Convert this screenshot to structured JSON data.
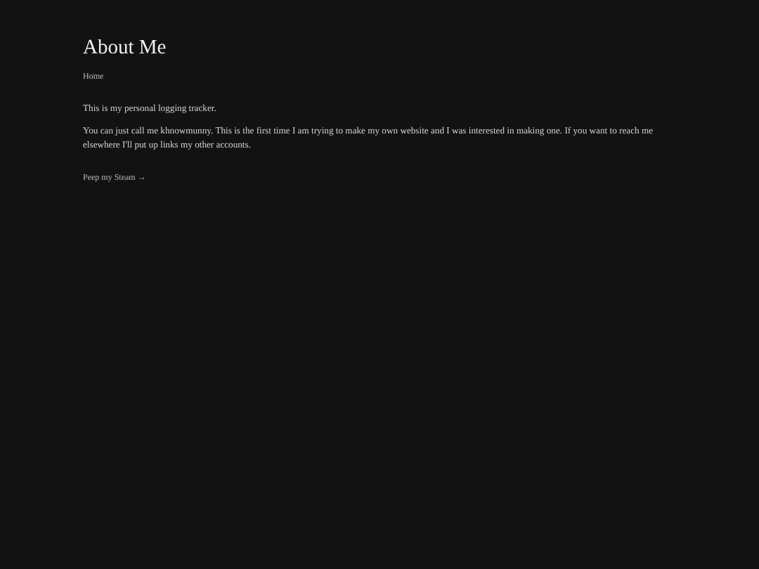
{
  "title": "About Me",
  "nav": {
    "label": "Home"
  },
  "paragraphs": [
    "This is my personal logging tracker.",
    "You can just call me khnowmunny. This is the first time I am trying to make my own website and I was interested in making one. If you want to reach me elsewhere I'll put up links my other accounts."
  ],
  "link": {
    "label": "Peep my Steam →"
  }
}
